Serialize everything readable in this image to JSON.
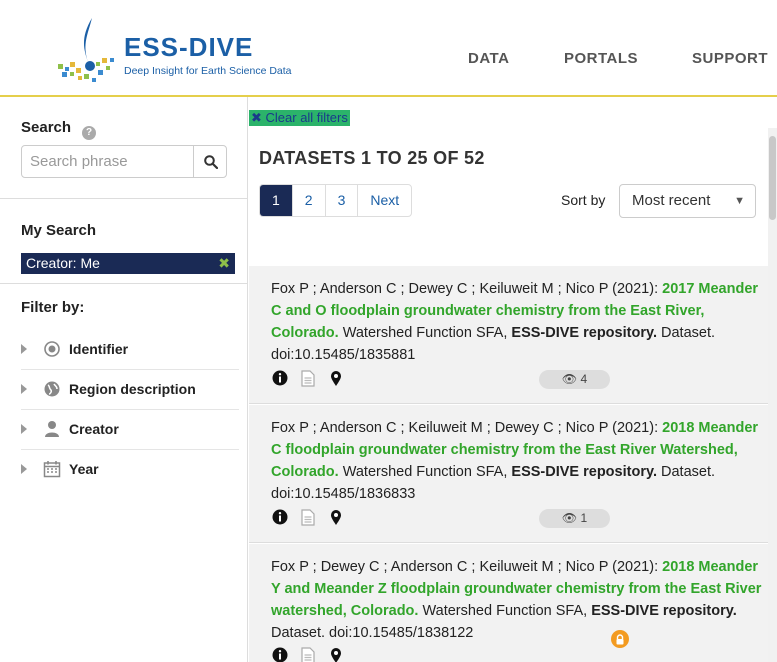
{
  "header": {
    "logo_title": "ESS-DIVE",
    "logo_subtitle": "Deep Insight for Earth Science Data",
    "nav": [
      "DATA",
      "PORTALS",
      "SUPPORT"
    ]
  },
  "sidebar": {
    "search_heading": "Search",
    "search_placeholder": "Search phrase",
    "my_search_heading": "My Search",
    "active_filter": "Creator: Me",
    "filter_by_heading": "Filter by:",
    "filters": [
      {
        "label": "Identifier",
        "icon": "target-icon"
      },
      {
        "label": "Region description",
        "icon": "globe-icon"
      },
      {
        "label": "Creator",
        "icon": "user-icon"
      },
      {
        "label": "Year",
        "icon": "calendar-icon"
      }
    ]
  },
  "main": {
    "clear_filters": "Clear all filters",
    "results_title": "DATASETS 1 TO 25 OF 52",
    "pages": [
      "1",
      "2",
      "3",
      "Next"
    ],
    "sort_label": "Sort by",
    "sort_value": "Most recent",
    "results": [
      {
        "authors": "Fox P ; Anderson C ; Dewey C ; Keiluweit M ; Nico P (2021): ",
        "title": "2017 Meander C and O floodplain groundwater chemistry from the East River, Colorado.",
        "project": " Watershed Function SFA, ",
        "repository": "ESS-DIVE repository.",
        "doi": " Dataset. doi:10.15485/1835881",
        "views": "4"
      },
      {
        "authors": "Fox P ; Anderson C ; Keiluweit M ; Dewey C ; Nico P (2021): ",
        "title": "2018 Meander C floodplain groundwater chemistry from the East River Watershed, Colorado.",
        "project": " Watershed Function SFA, ",
        "repository": "ESS-DIVE repository.",
        "doi": " Dataset. doi:10.15485/1836833",
        "views": "1"
      },
      {
        "authors": "Fox P ; Dewey C ; Anderson C ; Keiluweit M ; Nico P (2021): ",
        "title": "2018 Meander Y and Meander Z floodplain groundwater chemistry from the East River watershed, Colorado.",
        "project": " Watershed Function SFA, ",
        "repository": "ESS-DIVE repository.",
        "doi": " Dataset. doi:10.15485/1838122",
        "views": ""
      }
    ]
  }
}
